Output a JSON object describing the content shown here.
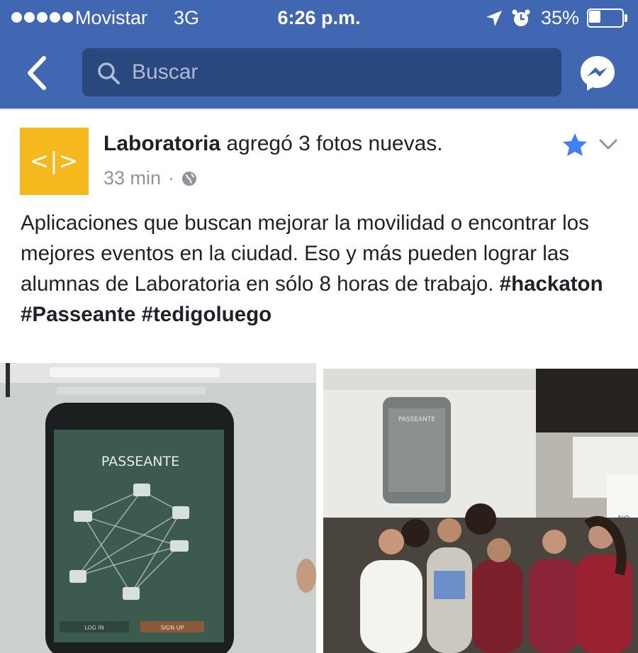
{
  "status_bar": {
    "carrier": "Movistar",
    "network": "3G",
    "time": "6:26 p.m.",
    "battery": "35%",
    "battery_level": 0.35,
    "icons": [
      "signal-dots-icon",
      "location-arrow-icon",
      "alarm-icon",
      "battery-icon"
    ]
  },
  "nav": {
    "search_placeholder": "Buscar",
    "icons": [
      "back-chevron-icon",
      "search-icon",
      "messenger-icon"
    ]
  },
  "post": {
    "page_name": "Laboratoria",
    "action": "agregó 3 fotos nuevas.",
    "avatar_logo": "<|>",
    "time_ago": "33 min",
    "meta_separator": "·",
    "text": "Aplicaciones que buscan mejorar la movilidad o encontrar los mejores eventos en la ciudad. Eso y más pueden lograr las alumnas de Laboratoria en sólo 8 horas de trabajo.",
    "hashtags": [
      "#hackaton",
      "#Passeante",
      "#tedigoluego"
    ],
    "icons": [
      "globe-icon",
      "star-icon",
      "chevron-down-icon"
    ],
    "colors": {
      "brand_bar": "#4267b2",
      "avatar_bg": "#f5b91d",
      "star": "#4080ff"
    }
  },
  "photos": {
    "left": {
      "app_title": "PASSEANTE",
      "login_label": "LOG IN",
      "signup_label": "SIGN UP"
    },
    "right": {
      "app_title": "PASSEANTE",
      "sign_text": "NO"
    }
  }
}
